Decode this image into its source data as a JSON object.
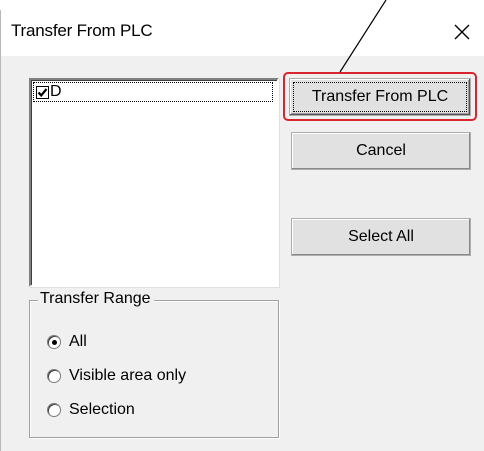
{
  "window": {
    "title": "Transfer From PLC",
    "close_glyph": "✕"
  },
  "device_list": {
    "items": [
      {
        "label": "D",
        "checked": true
      }
    ]
  },
  "buttons": {
    "transfer_label": "Transfer From PLC",
    "cancel_label": "Cancel",
    "select_all_label": "Select All"
  },
  "transfer_range": {
    "legend": "Transfer Range",
    "options": [
      {
        "label": "All",
        "selected": true
      },
      {
        "label": "Visible area only",
        "selected": false
      },
      {
        "label": "Selection",
        "selected": false
      }
    ]
  },
  "colors": {
    "highlight": "#d9262e",
    "dialog_bg": "#f0f0f0",
    "button_bg": "#e1e1e1"
  }
}
